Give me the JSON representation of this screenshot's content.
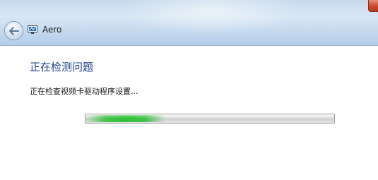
{
  "window": {
    "app_title": "Aero",
    "app_icon": "aero-monitor-icon",
    "back_icon": "back-arrow-icon"
  },
  "content": {
    "heading": "正在检测问题",
    "status_text": "正在检查视频卡驱动程序设置..."
  },
  "progress": {
    "indeterminate": true,
    "glow_start_fraction": 0.0,
    "glow_end_fraction": 0.32
  },
  "colors": {
    "heading": "#1e3f8c",
    "progress_glow": "#2fc237",
    "titlebar": "#c6d9ec"
  }
}
